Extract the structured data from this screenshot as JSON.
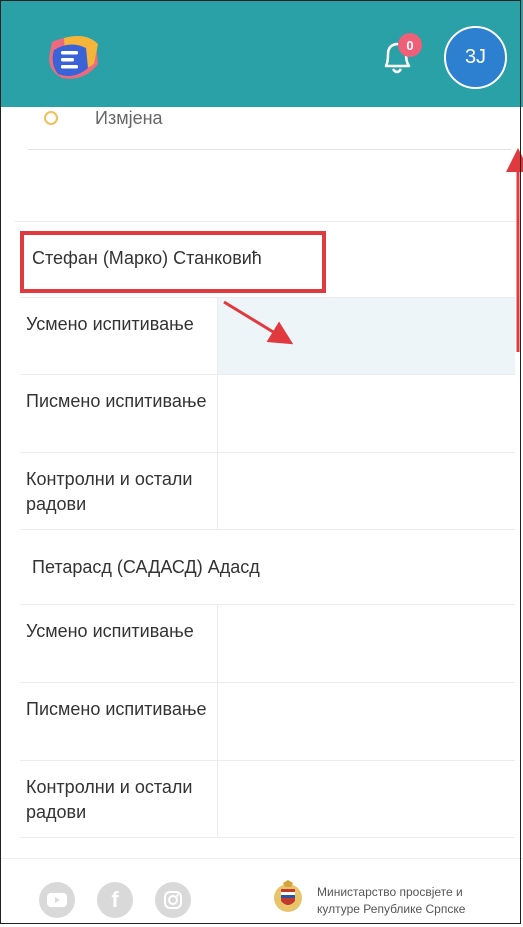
{
  "header": {
    "notification_count": "0",
    "avatar_initials": "3J"
  },
  "filter": {
    "option_label": "Измјена"
  },
  "students": [
    {
      "name": "Стефан (Марко) Станковић",
      "rows": [
        {
          "label": "Усмено испитивање"
        },
        {
          "label": "Писмено испитивање"
        },
        {
          "label": "Контролни и остали радови"
        }
      ]
    },
    {
      "name": "Петарасд (САДАСД) Адасд",
      "rows": [
        {
          "label": "Усмено испитивање"
        },
        {
          "label": "Писмено испитивање"
        },
        {
          "label": "Контролни и остали радови"
        }
      ]
    }
  ],
  "footer": {
    "ministry_line1": "Министарство просвјете и",
    "ministry_line2": "културе Републике Српске",
    "social_icons": [
      "youtube-icon",
      "facebook-icon",
      "instagram-icon"
    ]
  },
  "colors": {
    "header_bg": "#2aa0a7",
    "badge": "#ee6078",
    "avatar": "#2d7fd0",
    "highlight_row": "#eef5f8",
    "annotation": "#e0393e"
  }
}
